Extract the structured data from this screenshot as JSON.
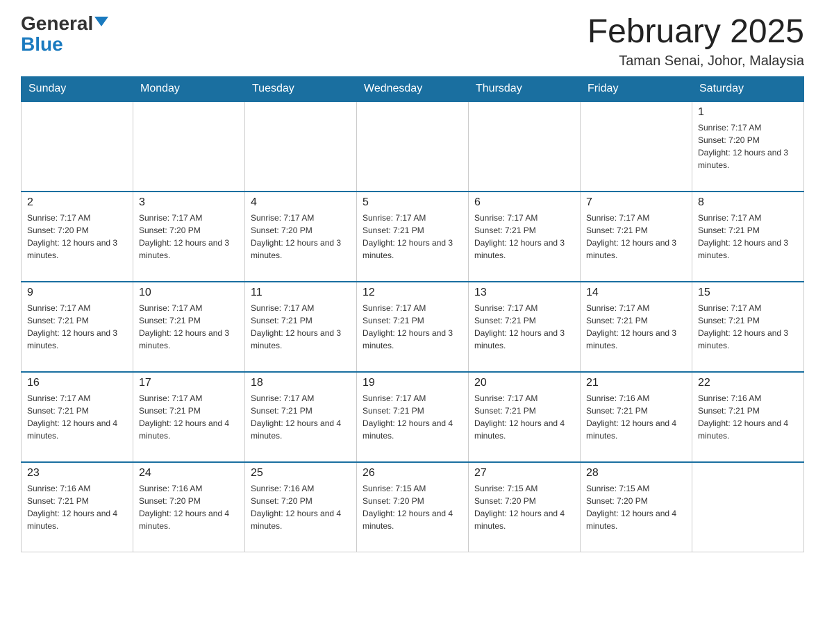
{
  "header": {
    "logo": {
      "general": "General",
      "blue": "Blue"
    },
    "title": "February 2025",
    "location": "Taman Senai, Johor, Malaysia"
  },
  "weekdays": [
    "Sunday",
    "Monday",
    "Tuesday",
    "Wednesday",
    "Thursday",
    "Friday",
    "Saturday"
  ],
  "weeks": [
    [
      {
        "day": "",
        "info": ""
      },
      {
        "day": "",
        "info": ""
      },
      {
        "day": "",
        "info": ""
      },
      {
        "day": "",
        "info": ""
      },
      {
        "day": "",
        "info": ""
      },
      {
        "day": "",
        "info": ""
      },
      {
        "day": "1",
        "info": "Sunrise: 7:17 AM\nSunset: 7:20 PM\nDaylight: 12 hours and 3 minutes."
      }
    ],
    [
      {
        "day": "2",
        "info": "Sunrise: 7:17 AM\nSunset: 7:20 PM\nDaylight: 12 hours and 3 minutes."
      },
      {
        "day": "3",
        "info": "Sunrise: 7:17 AM\nSunset: 7:20 PM\nDaylight: 12 hours and 3 minutes."
      },
      {
        "day": "4",
        "info": "Sunrise: 7:17 AM\nSunset: 7:20 PM\nDaylight: 12 hours and 3 minutes."
      },
      {
        "day": "5",
        "info": "Sunrise: 7:17 AM\nSunset: 7:21 PM\nDaylight: 12 hours and 3 minutes."
      },
      {
        "day": "6",
        "info": "Sunrise: 7:17 AM\nSunset: 7:21 PM\nDaylight: 12 hours and 3 minutes."
      },
      {
        "day": "7",
        "info": "Sunrise: 7:17 AM\nSunset: 7:21 PM\nDaylight: 12 hours and 3 minutes."
      },
      {
        "day": "8",
        "info": "Sunrise: 7:17 AM\nSunset: 7:21 PM\nDaylight: 12 hours and 3 minutes."
      }
    ],
    [
      {
        "day": "9",
        "info": "Sunrise: 7:17 AM\nSunset: 7:21 PM\nDaylight: 12 hours and 3 minutes."
      },
      {
        "day": "10",
        "info": "Sunrise: 7:17 AM\nSunset: 7:21 PM\nDaylight: 12 hours and 3 minutes."
      },
      {
        "day": "11",
        "info": "Sunrise: 7:17 AM\nSunset: 7:21 PM\nDaylight: 12 hours and 3 minutes."
      },
      {
        "day": "12",
        "info": "Sunrise: 7:17 AM\nSunset: 7:21 PM\nDaylight: 12 hours and 3 minutes."
      },
      {
        "day": "13",
        "info": "Sunrise: 7:17 AM\nSunset: 7:21 PM\nDaylight: 12 hours and 3 minutes."
      },
      {
        "day": "14",
        "info": "Sunrise: 7:17 AM\nSunset: 7:21 PM\nDaylight: 12 hours and 3 minutes."
      },
      {
        "day": "15",
        "info": "Sunrise: 7:17 AM\nSunset: 7:21 PM\nDaylight: 12 hours and 3 minutes."
      }
    ],
    [
      {
        "day": "16",
        "info": "Sunrise: 7:17 AM\nSunset: 7:21 PM\nDaylight: 12 hours and 4 minutes."
      },
      {
        "day": "17",
        "info": "Sunrise: 7:17 AM\nSunset: 7:21 PM\nDaylight: 12 hours and 4 minutes."
      },
      {
        "day": "18",
        "info": "Sunrise: 7:17 AM\nSunset: 7:21 PM\nDaylight: 12 hours and 4 minutes."
      },
      {
        "day": "19",
        "info": "Sunrise: 7:17 AM\nSunset: 7:21 PM\nDaylight: 12 hours and 4 minutes."
      },
      {
        "day": "20",
        "info": "Sunrise: 7:17 AM\nSunset: 7:21 PM\nDaylight: 12 hours and 4 minutes."
      },
      {
        "day": "21",
        "info": "Sunrise: 7:16 AM\nSunset: 7:21 PM\nDaylight: 12 hours and 4 minutes."
      },
      {
        "day": "22",
        "info": "Sunrise: 7:16 AM\nSunset: 7:21 PM\nDaylight: 12 hours and 4 minutes."
      }
    ],
    [
      {
        "day": "23",
        "info": "Sunrise: 7:16 AM\nSunset: 7:21 PM\nDaylight: 12 hours and 4 minutes."
      },
      {
        "day": "24",
        "info": "Sunrise: 7:16 AM\nSunset: 7:20 PM\nDaylight: 12 hours and 4 minutes."
      },
      {
        "day": "25",
        "info": "Sunrise: 7:16 AM\nSunset: 7:20 PM\nDaylight: 12 hours and 4 minutes."
      },
      {
        "day": "26",
        "info": "Sunrise: 7:15 AM\nSunset: 7:20 PM\nDaylight: 12 hours and 4 minutes."
      },
      {
        "day": "27",
        "info": "Sunrise: 7:15 AM\nSunset: 7:20 PM\nDaylight: 12 hours and 4 minutes."
      },
      {
        "day": "28",
        "info": "Sunrise: 7:15 AM\nSunset: 7:20 PM\nDaylight: 12 hours and 4 minutes."
      },
      {
        "day": "",
        "info": ""
      }
    ]
  ]
}
